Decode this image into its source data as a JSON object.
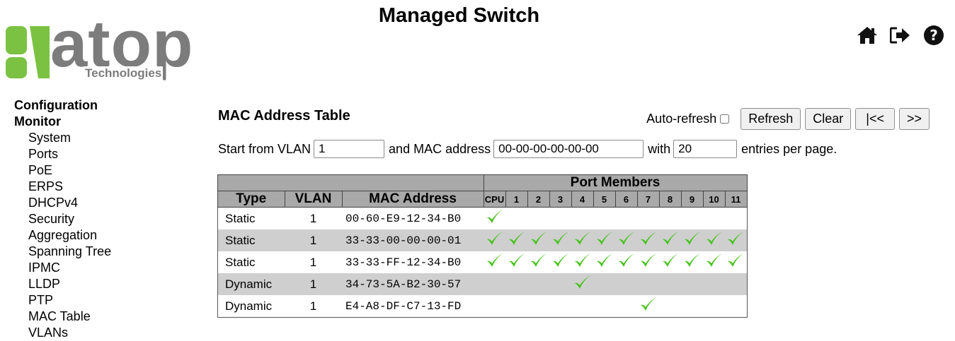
{
  "header": {
    "title": "Managed Switch",
    "logo_word": "atop",
    "logo_sub": "Technologies",
    "icons": [
      "home-icon",
      "logout-icon",
      "help-icon"
    ]
  },
  "nav": {
    "groups": [
      {
        "label": "Configuration"
      },
      {
        "label": "Monitor"
      }
    ],
    "items": [
      {
        "label": "System"
      },
      {
        "label": "Ports"
      },
      {
        "label": "PoE"
      },
      {
        "label": "ERPS"
      },
      {
        "label": "DHCPv4"
      },
      {
        "label": "Security"
      },
      {
        "label": "Aggregation"
      },
      {
        "label": "Spanning Tree"
      },
      {
        "label": "IPMC"
      },
      {
        "label": "LLDP"
      },
      {
        "label": "PTP"
      },
      {
        "label": "MAC Table"
      },
      {
        "label": "VLANs"
      }
    ]
  },
  "page": {
    "title": "MAC Address Table",
    "auto_refresh_label": "Auto-refresh",
    "auto_refresh_checked": false,
    "buttons": {
      "refresh": "Refresh",
      "clear": "Clear",
      "first": "|<<",
      "next": ">>"
    }
  },
  "search": {
    "vlan_label": "Start from VLAN",
    "vlan_value": "1",
    "mac_label": "and MAC address",
    "mac_value": "00-00-00-00-00-00",
    "with_label": "with",
    "entries_value": "20",
    "entries_label": "entries per page."
  },
  "table": {
    "port_members_label": "Port Members",
    "headers": {
      "type": "Type",
      "vlan": "VLAN",
      "mac": "MAC Address"
    },
    "ports": [
      "CPU",
      "1",
      "2",
      "3",
      "4",
      "5",
      "6",
      "7",
      "8",
      "9",
      "10",
      "11"
    ],
    "rows": [
      {
        "type": "Static",
        "vlan": "1",
        "mac": "00-60-E9-12-34-B0",
        "members": [
          true,
          false,
          false,
          false,
          false,
          false,
          false,
          false,
          false,
          false,
          false,
          false
        ]
      },
      {
        "type": "Static",
        "vlan": "1",
        "mac": "33-33-00-00-00-01",
        "members": [
          true,
          true,
          true,
          true,
          true,
          true,
          true,
          true,
          true,
          true,
          true,
          true
        ]
      },
      {
        "type": "Static",
        "vlan": "1",
        "mac": "33-33-FF-12-34-B0",
        "members": [
          true,
          true,
          true,
          true,
          true,
          true,
          true,
          true,
          true,
          true,
          true,
          true
        ]
      },
      {
        "type": "Dynamic",
        "vlan": "1",
        "mac": "34-73-5A-B2-30-57",
        "members": [
          false,
          false,
          false,
          false,
          true,
          false,
          false,
          false,
          false,
          false,
          false,
          false
        ]
      },
      {
        "type": "Dynamic",
        "vlan": "1",
        "mac": "E4-A8-DF-C7-13-FD",
        "members": [
          false,
          false,
          false,
          false,
          false,
          false,
          false,
          true,
          false,
          false,
          false,
          false
        ]
      }
    ]
  },
  "colors": {
    "header_bg": "#a9a9a9",
    "row_alt": "#cfcfcf",
    "check": "#46c21a",
    "logo_green": "#7bc242",
    "logo_gray": "#7c7c7c"
  }
}
